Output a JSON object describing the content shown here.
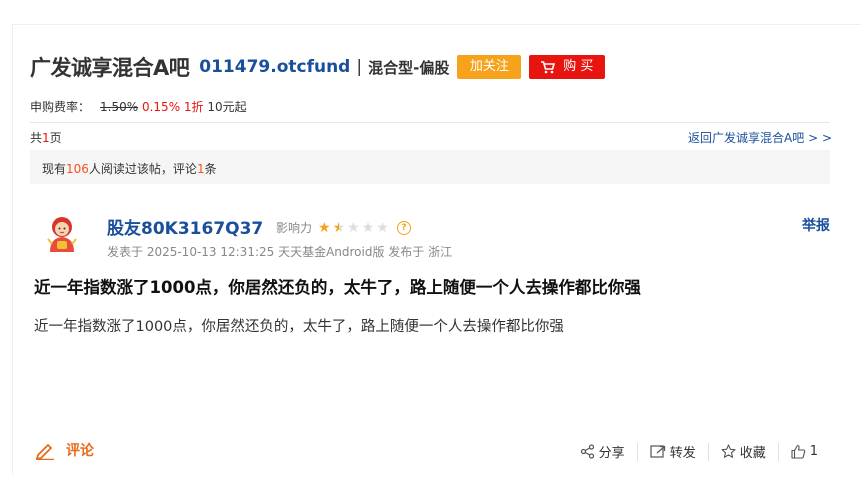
{
  "header": {
    "bar_name": "广发诚享混合A吧",
    "fund_code": "011479.otcfund",
    "separator": "|",
    "fund_type": "混合型-偏股",
    "follow_label": "加关注",
    "buy_label": "购 买"
  },
  "fee": {
    "label": "申购费率：",
    "original_rate": "1.50%",
    "discount_rate": "0.15%",
    "discount": "1折",
    "min_amount": "10元起"
  },
  "pagination": {
    "prefix": "共",
    "count": "1",
    "suffix": "页",
    "back_link": "返回广发诚享混合A吧 > >"
  },
  "read_info": {
    "prefix": "现有",
    "read_count": "106",
    "middle": "人阅读过该帖，评论",
    "comment_count": "1",
    "suffix": "条"
  },
  "post": {
    "author": "股友80K3167Q37",
    "influence_label": "影响力",
    "influence_stars": 1.5,
    "influence_max": 5,
    "meta": "发表于 2025-10-13 12:31:25 天天基金Android版 发布于 浙江",
    "report_label": "举报",
    "title": "近一年指数涨了1000点，你居然还负的，太牛了，路上随便一个人去操作都比你强",
    "body": "近一年指数涨了1000点，你居然还负的，太牛了，路上随便一个人去操作都比你强"
  },
  "footer": {
    "comment_label": "评论",
    "share_label": "分享",
    "repost_label": "转发",
    "favorite_label": "收藏",
    "like_count": "1"
  },
  "colors": {
    "link_blue": "#1a4f9c",
    "follow_orange": "#f7a21b",
    "buy_red": "#e8140f",
    "comment_orange": "#e86b1c"
  }
}
